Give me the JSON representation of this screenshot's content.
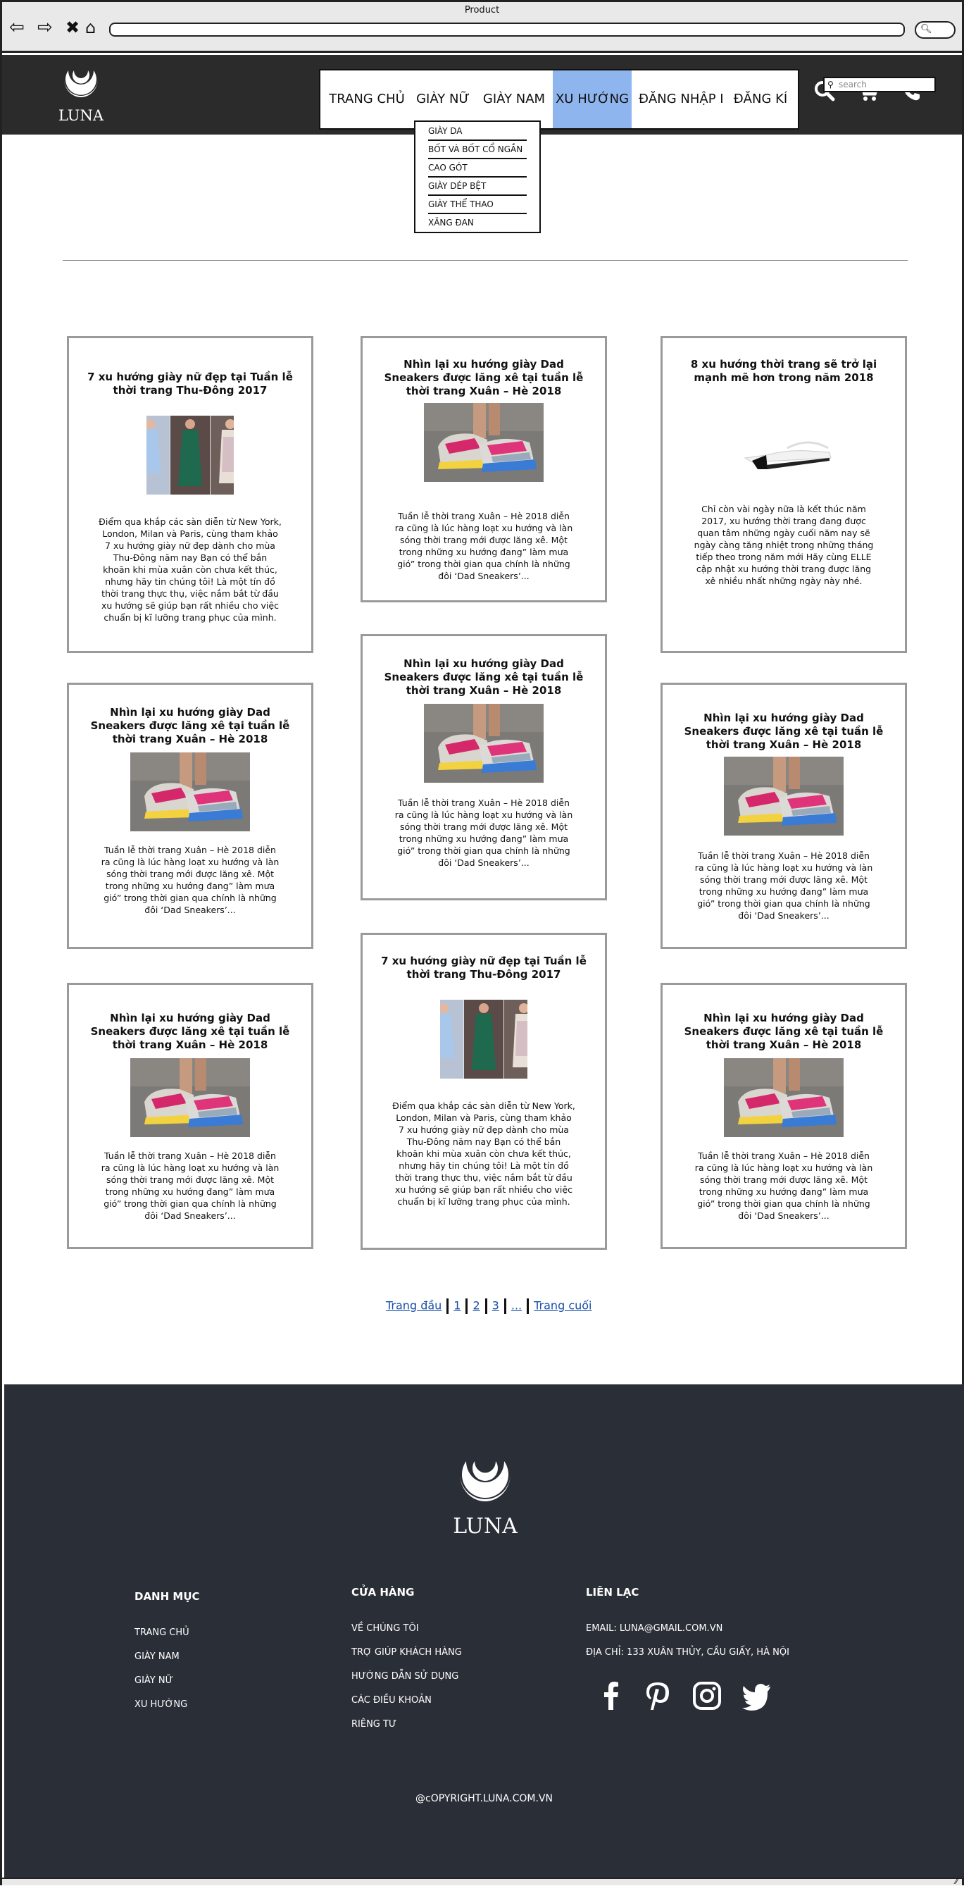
{
  "browser": {
    "window_title": "Product"
  },
  "header": {
    "logo_text": "LUNA",
    "menu": [
      "TRANG CHỦ",
      "GIÀY NỮ",
      "GIÀY NAM",
      "XU HƯỚNG",
      "ĐĂNG NHẬP I",
      "ĐĂNG KÍ"
    ],
    "search_placeholder": "search",
    "icons": [
      "search-icon",
      "cart-icon",
      "phone-icon"
    ],
    "active_color": "#8fb5ee"
  },
  "dropdown": [
    "GIÀY DA",
    "BỐT VÀ BỐT CỔ NGẮN",
    "CAO GÓT",
    "GIÀY DÉP BỆT",
    "GIÀY THỂ THAO",
    "XĂNG ĐAN"
  ],
  "cards": [
    {
      "title": "7 xu hướng giày nữ đẹp tại Tuần lễ thời trang Thu-Đông 2017",
      "text": "Điểm qua khắp các sàn diễn từ New York, London, Milan và Paris, cùng tham khảo 7 xu hướng giày nữ đẹp dành cho mùa Thu-Đông năm nay Bạn có thể bắn khoăn khi mùa xuân còn chưa kết thúc, nhưng hãy tin chúng tôi! Là một tín đồ thời trang thực thụ, việc nắm bắt từ đầu xu hướng sẽ giúp bạn rất nhiều cho việc chuẩn bị kĩ lưỡng trang phục của mình.",
      "image": "runway"
    },
    {
      "title": "Nhìn lại xu hướng giày Dad Sneakers được lăng xê tại tuần lễ thời trang Xuân – Hè 2018",
      "text": "Tuần lễ thời trang Xuân – Hè 2018 diễn ra cũng là lúc hàng loạt xu hướng và làn sóng thời trang mới được lăng xê. Một trong những xu hướng đang” làm mưa gió” trong thời gian qua chính là những đôi ‘Dad Sneakers’...",
      "image": "sneaker"
    },
    {
      "title": "8 xu hướng thời trang sẽ trở lại mạnh mẽ hơn trong năm 2018",
      "text": "Chỉ còn vài ngày nữa là kết thúc năm 2017, xu hướng thời trang đang được quan tâm những ngày cuối năm nay sẽ ngày càng tăng nhiệt trong những tháng tiếp theo trong năm mới Hãy cùng ELLE cập nhật xu hướng thời trang được lăng xê nhiều nhất những ngày này nhé.",
      "image": "wedge"
    },
    {
      "title": "Nhìn lại xu hướng giày Dad Sneakers được lăng xê tại tuần lễ thời trang Xuân – Hè 2018",
      "text": "Tuần lễ thời trang Xuân – Hè 2018 diễn ra cũng là lúc hàng loạt xu hướng và làn sóng thời trang mới được lăng xê. Một trong những xu hướng đang” làm mưa gió” trong thời gian qua chính là những đôi ‘Dad Sneakers’...",
      "image": "sneaker"
    },
    {
      "title": "Nhìn lại xu hướng giày Dad Sneakers được lăng xê tại tuần lễ thời trang Xuân – Hè 2018",
      "text": "Tuần lễ thời trang Xuân – Hè 2018 diễn ra cũng là lúc hàng loạt xu hướng và làn sóng thời trang mới được lăng xê. Một trong những xu hướng đang” làm mưa gió” trong thời gian qua chính là những đôi ‘Dad Sneakers’...",
      "image": "sneaker"
    },
    {
      "title": "Nhìn lại xu hướng giày Dad Sneakers được lăng xê tại tuần lễ thời trang Xuân – Hè 2018",
      "text": "Tuần lễ thời trang Xuân – Hè 2018 diễn ra cũng là lúc hàng loạt xu hướng và làn sóng thời trang mới được lăng xê. Một trong những xu hướng đang” làm mưa gió” trong thời gian qua chính là những đôi ‘Dad Sneakers’...",
      "image": "sneaker"
    },
    {
      "title": "Nhìn lại xu hướng giày Dad Sneakers được lăng xê tại tuần lễ thời trang Xuân – Hè 2018",
      "text": "Tuần lễ thời trang Xuân – Hè 2018 diễn ra cũng là lúc hàng loạt xu hướng và làn sóng thời trang mới được lăng xê. Một trong những xu hướng đang” làm mưa gió” trong thời gian qua chính là những đôi ‘Dad Sneakers’...",
      "image": "sneaker"
    },
    {
      "title": "7 xu hướng giày nữ đẹp tại Tuần lễ thời trang Thu-Đông 2017",
      "text": "Điểm qua khắp các sàn diễn từ New York, London, Milan và Paris, cùng tham khảo 7 xu hướng giày nữ đẹp dành cho mùa Thu-Đông năm nay Bạn có thể bắn khoăn khi mùa xuân còn chưa kết thúc, nhưng hãy tin chúng tôi! Là một tín đồ thời trang thực thụ, việc nắm bắt từ đầu xu hướng sẽ giúp bạn rất nhiều cho việc chuẩn bị kĩ lưỡng trang phục của mình.",
      "image": "runway"
    },
    {
      "title": "Nhìn lại xu hướng giày Dad Sneakers được lăng xê tại tuần lễ thời trang Xuân – Hè 2018",
      "text": "Tuần lễ thời trang Xuân – Hè 2018 diễn ra cũng là lúc hàng loạt xu hướng và làn sóng thời trang mới được lăng xê. Một trong những xu hướng đang” làm mưa gió” trong thời gian qua chính là những đôi ‘Dad Sneakers’...",
      "image": "sneaker"
    }
  ],
  "pagination": {
    "first": "Trang đầu",
    "pages": [
      "1",
      "2",
      "3",
      "..."
    ],
    "last": "Trang cuối"
  },
  "footer": {
    "logo_text": "LUNA",
    "col1": {
      "heading": "DANH MỤC",
      "links": [
        "TRANG CHỦ",
        "GIÀY NAM",
        "GIÀY NỮ",
        "XU HƯỚNG"
      ]
    },
    "col2": {
      "heading": "CỬA HÀNG",
      "links": [
        "VỀ CHÚNG TÔI",
        "TRỢ GIÚP KHÁCH HÀNG",
        "HƯỚNG DẪN SỬ DỤNG",
        "CÁC ĐIỀU KHOẢN",
        "RIÊNG TƯ"
      ]
    },
    "col3": {
      "heading": "LIÊN LẠC",
      "email": "EMAIL: LUNA@GMAIL.COM.VN",
      "address": "ĐỊA CHỈ: 133 XUÂN THỦY, CẦU GIẤY, HÀ NỘI"
    },
    "social": [
      "facebook-icon",
      "pinterest-icon",
      "instagram-icon",
      "twitter-icon"
    ],
    "copyright": "@cOPYRIGHT.LUNA.COM.VN",
    "bg": "#2a2e37"
  }
}
